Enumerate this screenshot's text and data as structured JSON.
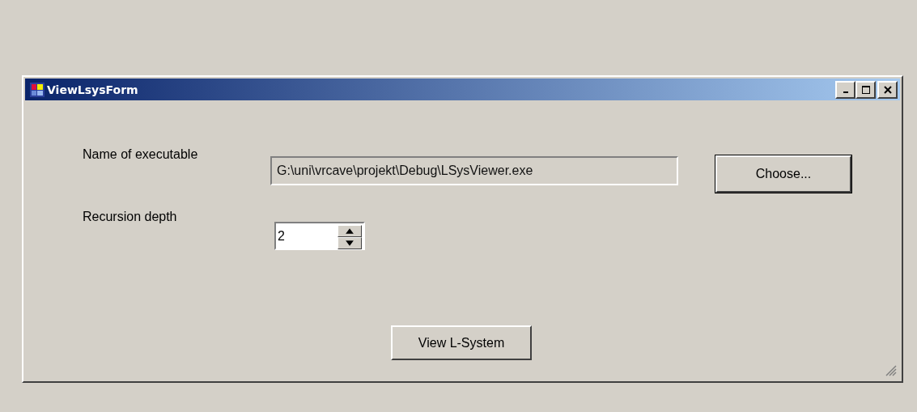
{
  "window": {
    "title": "ViewLsysForm"
  },
  "executable": {
    "label": "Name of executable",
    "value": "G:\\uni\\vrcave\\projekt\\Debug\\LSysViewer.exe",
    "disabled": true
  },
  "choose_button": {
    "label": "Choose...",
    "default": true
  },
  "recursion": {
    "label": "Recursion depth",
    "value": "2"
  },
  "view_button": {
    "label": "View L-System",
    "default": false
  }
}
